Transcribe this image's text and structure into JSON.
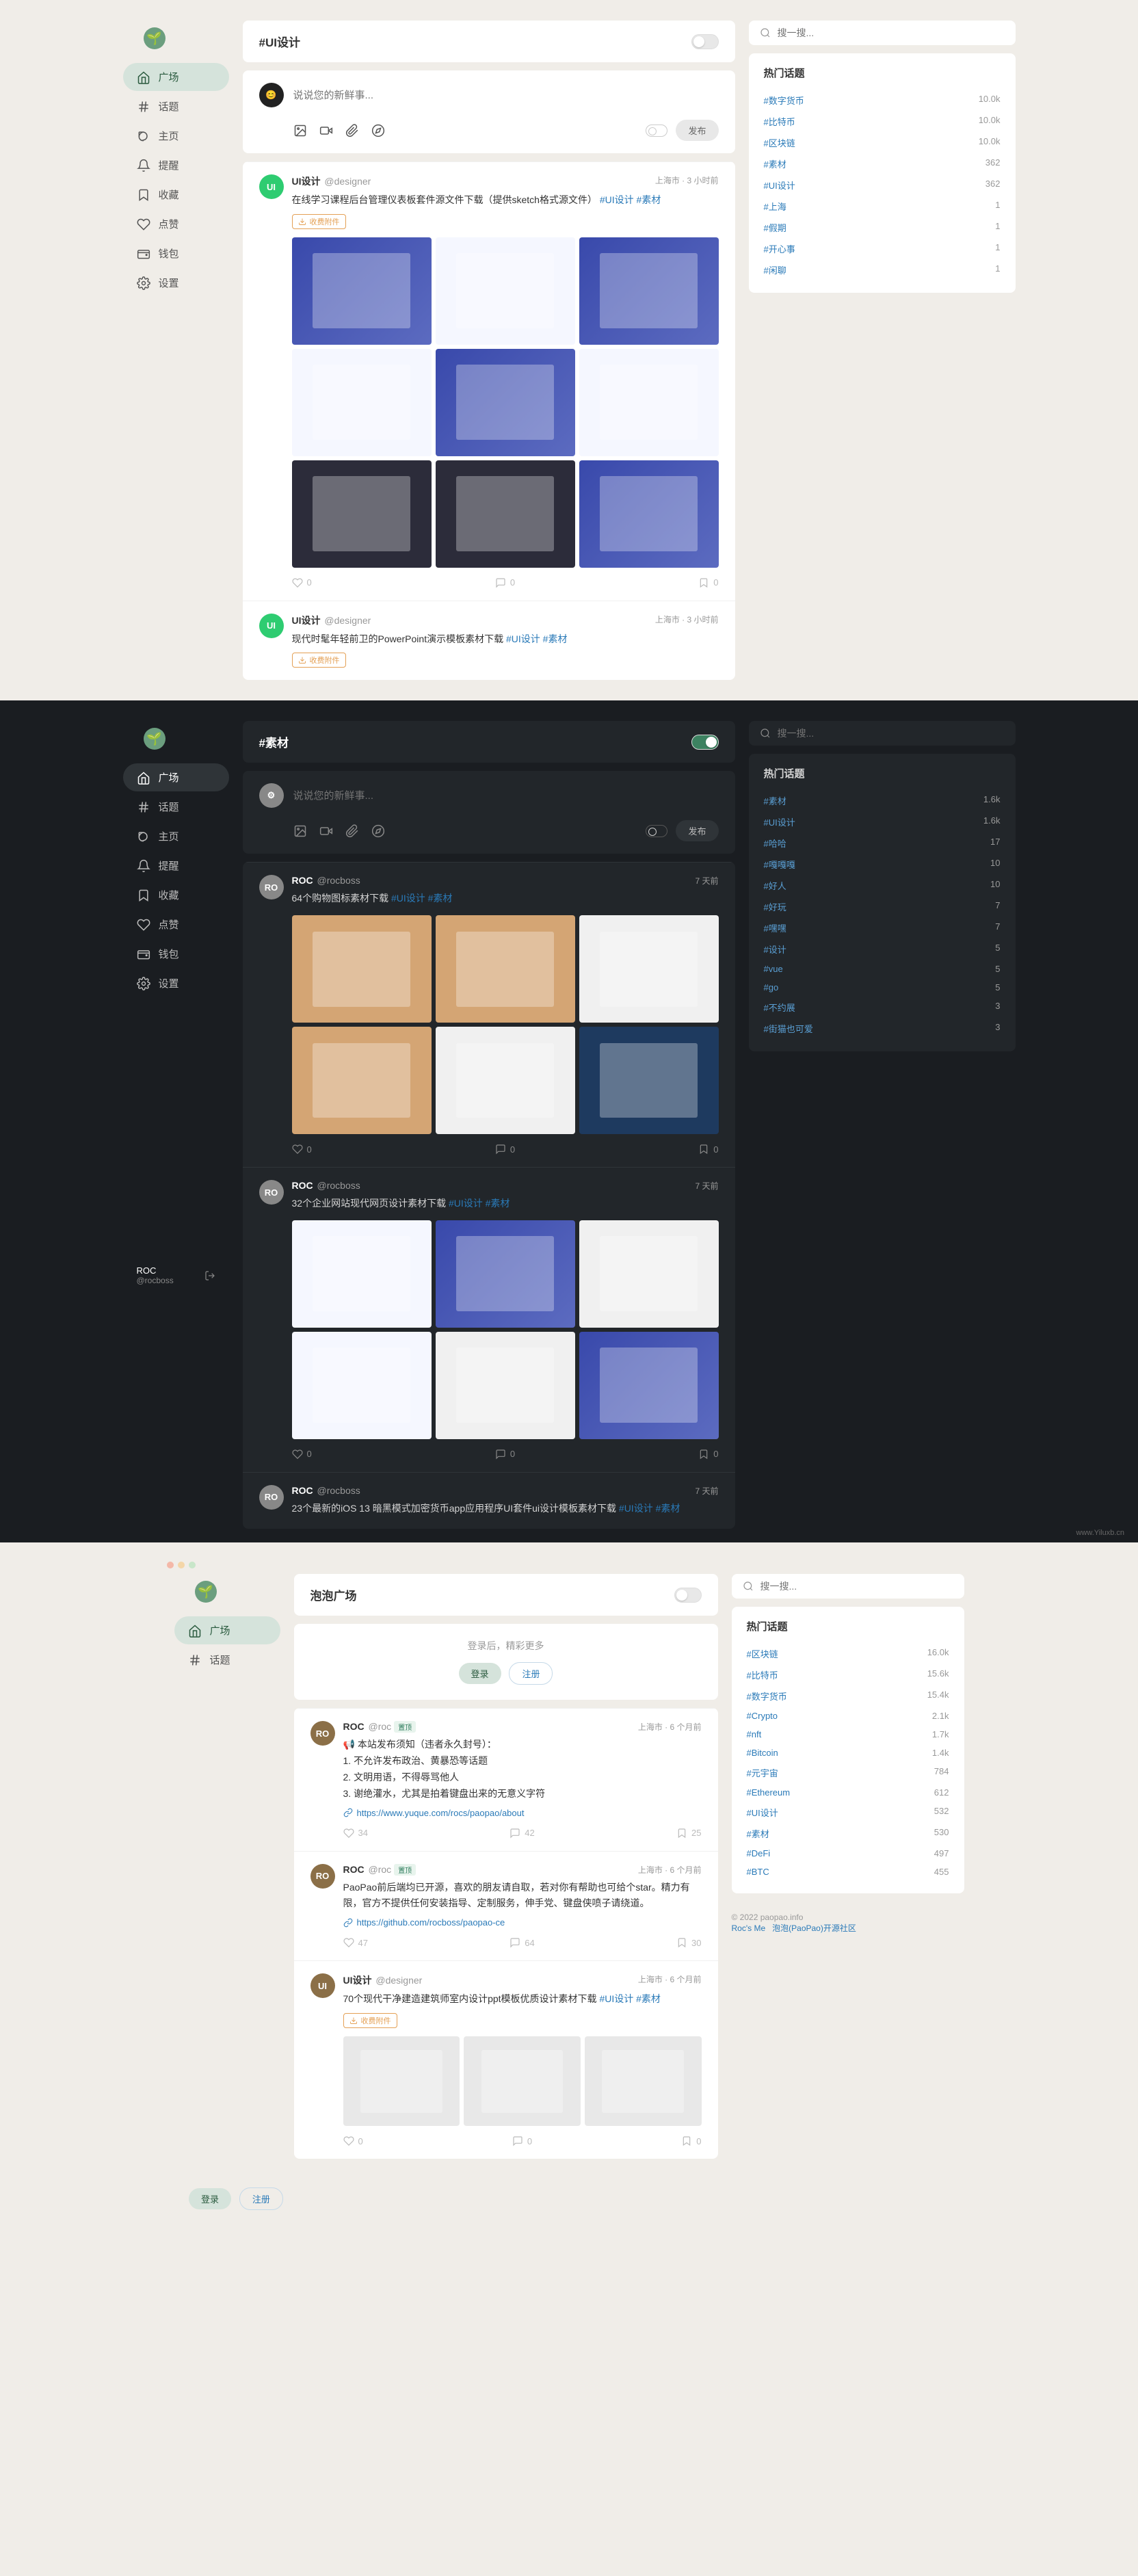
{
  "section1": {
    "header": "#UI设计",
    "nav": [
      {
        "icon": "home",
        "label": "广场",
        "active": true
      },
      {
        "icon": "hash",
        "label": "话题"
      },
      {
        "icon": "leaf",
        "label": "主页"
      },
      {
        "icon": "bell",
        "label": "提醒"
      },
      {
        "icon": "bookmark",
        "label": "收藏"
      },
      {
        "icon": "heart",
        "label": "点赞"
      },
      {
        "icon": "wallet",
        "label": "钱包"
      },
      {
        "icon": "gear",
        "label": "设置"
      }
    ],
    "compose_placeholder": "说说您的新鲜事...",
    "publish": "发布",
    "search_placeholder": "搜一搜...",
    "hot_title": "热门话题",
    "hot": [
      {
        "tag": "#数字货币",
        "count": "10.0k"
      },
      {
        "tag": "#比特币",
        "count": "10.0k"
      },
      {
        "tag": "#区块链",
        "count": "10.0k"
      },
      {
        "tag": "#素材",
        "count": "362"
      },
      {
        "tag": "#UI设计",
        "count": "362"
      },
      {
        "tag": "#上海",
        "count": "1"
      },
      {
        "tag": "#假期",
        "count": "1"
      },
      {
        "tag": "#开心事",
        "count": "1"
      },
      {
        "tag": "#闲聊",
        "count": "1"
      }
    ],
    "posts": [
      {
        "user": "UI设计",
        "handle": "@designer",
        "time": "上海市 · 3 小时前",
        "content": "在线学习课程后台管理仪表板套件源文件下载（提供sketch格式源文件）",
        "tags": "#UI设计 #素材",
        "attach": "收费附件",
        "images": 9
      },
      {
        "user": "UI设计",
        "handle": "@designer",
        "time": "上海市 · 3 小时前",
        "content": "现代时髦年轻前卫的PowerPoint演示模板素材下载 ",
        "tags": "#UI设计 #素材",
        "attach": "收费附件"
      }
    ]
  },
  "section2": {
    "header": "#素材",
    "nav_same": true,
    "compose_placeholder": "说说您的新鲜事...",
    "publish": "发布",
    "search_placeholder": "搜一搜...",
    "hot_title": "热门话题",
    "hot": [
      {
        "tag": "#素材",
        "count": "1.6k"
      },
      {
        "tag": "#UI设计",
        "count": "1.6k"
      },
      {
        "tag": "#哈哈",
        "count": "17"
      },
      {
        "tag": "#嘎嘎嘎",
        "count": "10"
      },
      {
        "tag": "#好人",
        "count": "10"
      },
      {
        "tag": "#好玩",
        "count": "7"
      },
      {
        "tag": "#嘿嘿",
        "count": "7"
      },
      {
        "tag": "#设计",
        "count": "5"
      },
      {
        "tag": "#vue",
        "count": "5"
      },
      {
        "tag": "#go",
        "count": "5"
      },
      {
        "tag": "#不约展",
        "count": "3"
      },
      {
        "tag": "#街猫也可爱",
        "count": "3"
      }
    ],
    "posts": [
      {
        "user": "ROC",
        "handle": "@rocboss",
        "time": "7 天前",
        "content": "64个购物图标素材下载 ",
        "tags": "#UI设计 #素材",
        "images": 6
      },
      {
        "user": "ROC",
        "handle": "@rocboss",
        "time": "7 天前",
        "content": "32个企业网站现代网页设计素材下载 ",
        "tags": "#UI设计 #素材",
        "images": 6
      },
      {
        "user": "ROC",
        "handle": "@rocboss",
        "time": "7 天前",
        "content": "23个最新的iOS 13 暗黑模式加密货币app应用程序UI套件ui设计模板素材下载 ",
        "tags": "#UI设计 #素材"
      }
    ],
    "user": {
      "name": "ROC",
      "handle": "@rocboss"
    },
    "watermark": "www.Yiluxb.cn"
  },
  "section3": {
    "header": "泡泡广场",
    "nav": [
      {
        "icon": "home",
        "label": "广场",
        "active": true
      },
      {
        "icon": "hash",
        "label": "话题"
      }
    ],
    "login_prompt": "登录后，精彩更多",
    "login_btn": "登录",
    "register_btn": "注册",
    "search_placeholder": "搜一搜...",
    "hot_title": "热门话题",
    "hot": [
      {
        "tag": "#区块链",
        "count": "16.0k"
      },
      {
        "tag": "#比特币",
        "count": "15.6k"
      },
      {
        "tag": "#数字货币",
        "count": "15.4k"
      },
      {
        "tag": "#Crypto",
        "count": "2.1k"
      },
      {
        "tag": "#nft",
        "count": "1.7k"
      },
      {
        "tag": "#Bitcoin",
        "count": "1.4k"
      },
      {
        "tag": "#元宇宙",
        "count": "784"
      },
      {
        "tag": "#Ethereum",
        "count": "612"
      },
      {
        "tag": "#UI设计",
        "count": "532"
      },
      {
        "tag": "#素材",
        "count": "530"
      },
      {
        "tag": "#DeFi",
        "count": "497"
      },
      {
        "tag": "#BTC",
        "count": "455"
      }
    ],
    "footer": {
      "copy": "© 2022 paopao.info",
      "link1": "Roc's Me",
      "link2": "泡泡(PaoPao)开源社区"
    },
    "posts": [
      {
        "user": "ROC",
        "handle": "@roc",
        "badge": "置顶",
        "time": "上海市 · 6 个月前",
        "content": "📢 本站发布须知（违者永久封号）：\n1. 不允许发布政治、黄暴恐等话题\n2. 文明用语，不得辱骂他人\n3. 谢绝灌水，尤其是拍着键盘出来的无意义字符",
        "link": "https://www.yuque.com/rocs/paopao/about",
        "stats": {
          "like": "34",
          "comment": "42",
          "bookmark": "25"
        }
      },
      {
        "user": "ROC",
        "handle": "@roc",
        "badge": "置顶",
        "time": "上海市 · 6 个月前",
        "content": "PaoPao前后端均已开源，喜欢的朋友请自取，若对你有帮助也可给个star。精力有限，官方不提供任何安装指导、定制服务，伸手党、键盘侠喷子请绕道。",
        "link": "https://github.com/rocboss/paopao-ce",
        "stats": {
          "like": "47",
          "comment": "64",
          "bookmark": "30"
        }
      },
      {
        "user": "UI设计",
        "handle": "@designer",
        "time": "上海市 · 6 个月前",
        "content": "70个现代干净建造建筑师室内设计ppt模板优质设计素材下载 ",
        "tags": "#UI设计 #素材",
        "attach": "收费附件",
        "images": 3
      }
    ]
  }
}
